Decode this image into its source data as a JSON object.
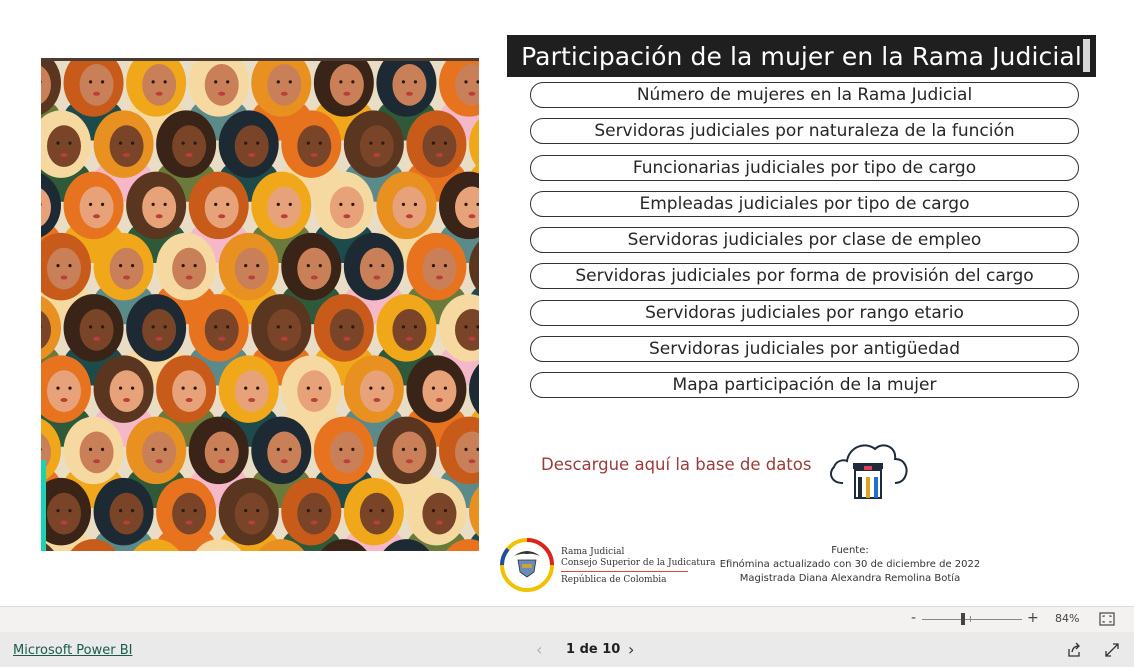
{
  "report": {
    "title": "Participación de la mujer en la Rama Judicial",
    "nav_buttons": [
      "Número de mujeres en la Rama Judicial",
      "Servidoras judiciales por naturaleza de la función",
      "Funcionarias judiciales por tipo de cargo",
      "Empleadas judiciales por tipo de cargo",
      "Servidoras judiciales por clase de empleo",
      "Servidoras judiciales por forma de provisión del cargo",
      "Servidoras judiciales por rango etario",
      "Servidoras judiciales por antigüedad",
      "Mapa participación de la mujer"
    ],
    "download_label": "Descargue aquí la base de datos",
    "logo": {
      "line1": "Rama Judicial",
      "line2": "Consejo Superior de la Judicatura",
      "line3": "República de Colombia"
    },
    "source": {
      "heading": "Fuente:",
      "line1": "Efinómina actualizado con  30 de diciembre de 2022",
      "line2": "Magistrada Diana Alexandra Remolina Botía"
    }
  },
  "zoom": {
    "minus": "-",
    "plus": "+",
    "level": "84%"
  },
  "footer": {
    "brand": "Microsoft Power BI",
    "prev": "‹",
    "page": "1 de 10",
    "next": "›"
  },
  "colors": {
    "title_bg": "#1f1f1f",
    "download_text": "#9a3a3a",
    "accent": "#19d3b2",
    "brand_link": "#1a5c4b"
  },
  "icons": {
    "cloud": "cloud-download-icon",
    "share": "share-icon",
    "expand": "expand-icon",
    "fit": "fit-page-icon"
  }
}
